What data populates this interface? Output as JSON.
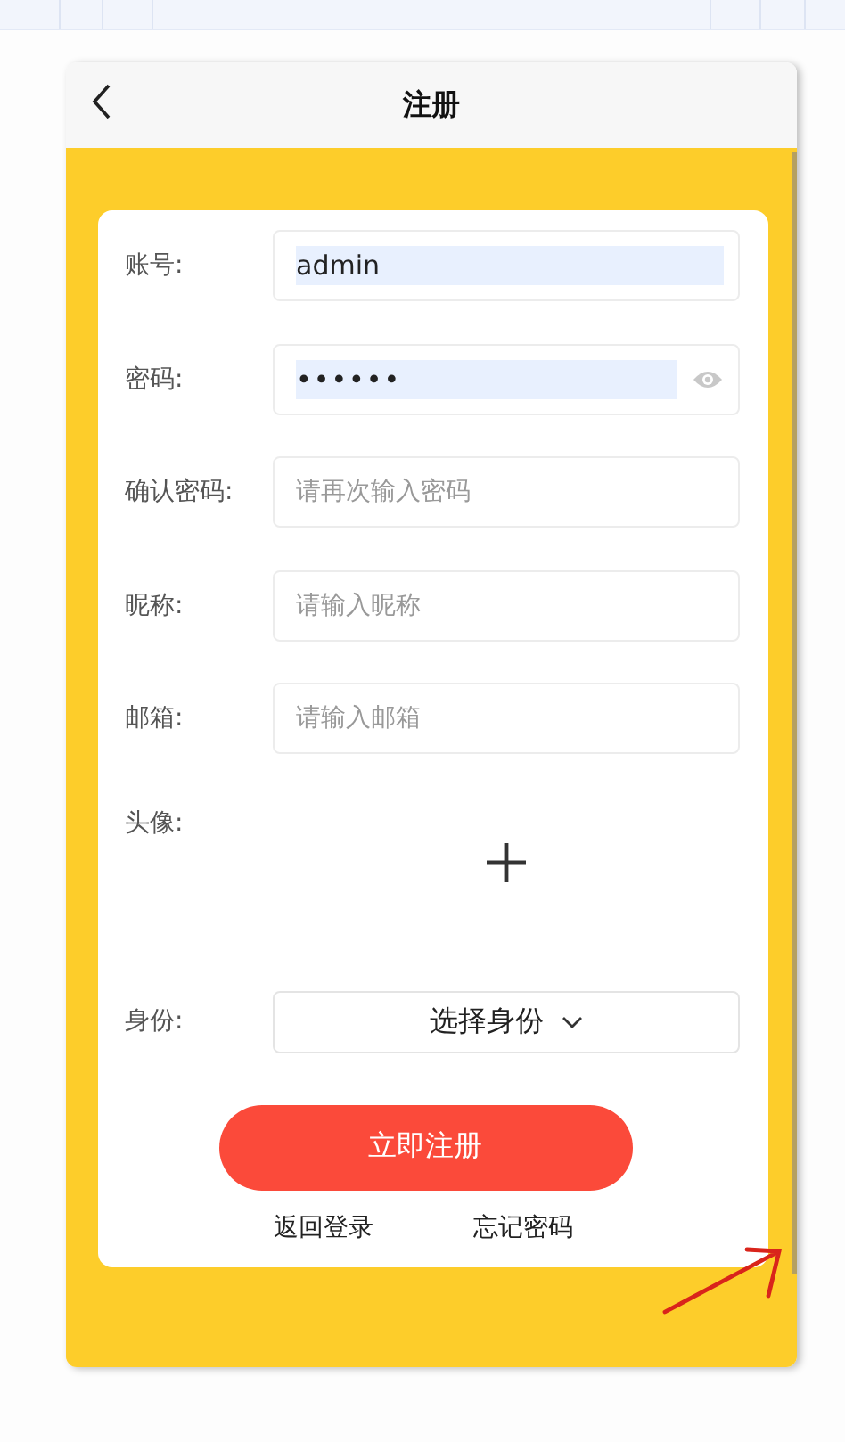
{
  "header": {
    "title": "注册"
  },
  "fields": [
    {
      "kind": "input",
      "label": "账号:",
      "value": "admin",
      "highlighted": true
    },
    {
      "kind": "password",
      "label": "密码:",
      "value": "••••••",
      "highlighted": true
    },
    {
      "kind": "input",
      "label": "确认密码:",
      "placeholder": "请再次输入密码",
      "highlighted": false
    },
    {
      "kind": "input",
      "label": "昵称:",
      "placeholder": "请输入昵称",
      "highlighted": false
    },
    {
      "kind": "input",
      "label": "邮箱:",
      "placeholder": "请输入邮箱",
      "highlighted": false
    },
    {
      "kind": "avatar",
      "label": "头像:"
    },
    {
      "kind": "select",
      "label": "身份:",
      "value": "选择身份"
    }
  ],
  "submit": "立即注册",
  "links": [
    "返回登录",
    "忘记密码"
  ]
}
